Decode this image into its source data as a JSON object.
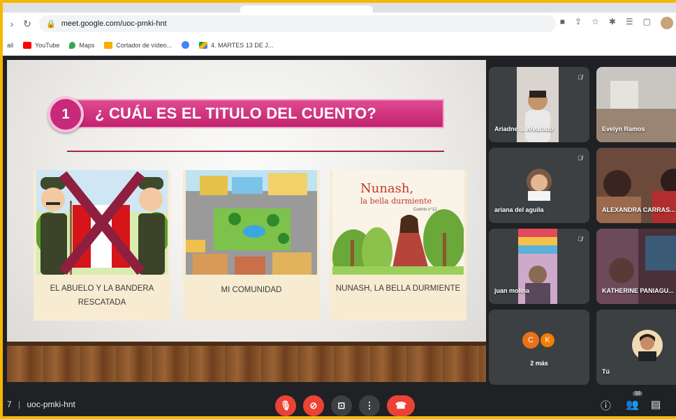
{
  "browser": {
    "url": "meet.google.com/uoc-pmki-hnt",
    "bookmarks": [
      {
        "label": "ail",
        "icon": "none",
        "color": "#ffffff"
      },
      {
        "label": "YouTube",
        "icon": "youtube-icon",
        "color": "#ff0000"
      },
      {
        "label": "Maps",
        "icon": "maps-icon",
        "color": "#34a853"
      },
      {
        "label": "Cortador de vídeo...",
        "icon": "video-cutter-icon",
        "color": "#f9ab00"
      },
      {
        "label": "",
        "icon": "chrome-icon",
        "color": "#4285f4"
      },
      {
        "label": "4. MARTES 13 DE J...",
        "icon": "drive-icon",
        "color": "#0f9d58"
      }
    ]
  },
  "slide": {
    "number": "1",
    "question": "¿ CUÁL ES EL TITULO DEL CUENTO?",
    "cards": [
      {
        "label": "EL ABUELO Y LA BANDERA RESCATADA",
        "crossed": true
      },
      {
        "label": "MI COMUNIDAD",
        "crossed": false
      },
      {
        "label": "NUNASH, LA BELLA DURMIENTE",
        "crossed": false,
        "book_title": "Nunash,",
        "book_subtitle": "la bella durmiente",
        "book_note": "Cuento n°12"
      }
    ]
  },
  "participants": [
    {
      "name": "Ariadne ... Alvarado",
      "muted": true
    },
    {
      "name": "Evelyn Ramos",
      "muted": false
    },
    {
      "name": "ariana del aguila",
      "muted": true
    },
    {
      "name": "ALEXANDRA CARRAS...",
      "muted": false,
      "active": true
    },
    {
      "name": "juan molina",
      "muted": true
    },
    {
      "name": "KATHERINE PANIAGU...",
      "muted": false
    },
    {
      "name": "2 más",
      "muted": false,
      "initials": [
        "C",
        "K"
      ],
      "initial_colors": [
        "#e8711a",
        "#f57c00"
      ]
    },
    {
      "name": "Tú",
      "muted": false
    }
  ],
  "bottom_bar": {
    "meeting_code_prefix": "7",
    "meeting_code": "uoc-pmki-hnt",
    "people_count": "10",
    "controls": [
      "mic-off",
      "camera-off",
      "present",
      "more",
      "hang-up"
    ]
  },
  "colors": {
    "frame": "#f5b800",
    "meet_bg": "#202124",
    "danger": "#ea4335",
    "slide_accent": "#c62a79"
  }
}
